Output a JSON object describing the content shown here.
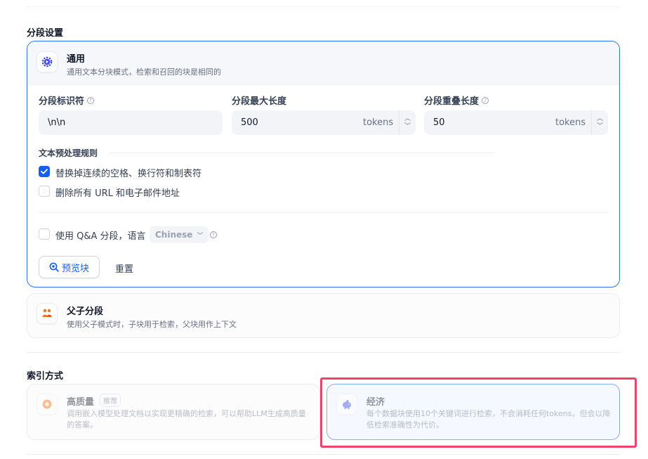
{
  "segment_section": {
    "title": "分段设置"
  },
  "general": {
    "title": "通用",
    "description": "通用文本分块模式，检索和召回的块是相同的",
    "separator": {
      "label": "分段标识符",
      "value": "\\n\\n"
    },
    "max_length": {
      "label": "分段最大长度",
      "value": "500",
      "unit": "tokens"
    },
    "overlap": {
      "label": "分段重叠长度",
      "value": "50",
      "unit": "tokens"
    },
    "rules": {
      "title": "文本预处理规则",
      "items": [
        {
          "label": "替换掉连续的空格、换行符和制表符",
          "checked": true
        },
        {
          "label": "删除所有 URL 和电子邮件地址",
          "checked": false
        }
      ]
    },
    "qa": {
      "label": "使用 Q&A 分段，语言",
      "language": "Chinese",
      "checked": false
    },
    "preview_button": "预览块",
    "reset_button": "重置"
  },
  "parent_child": {
    "title": "父子分段",
    "description": "使用父子模式时，子块用于检索，父块用作上下文"
  },
  "index_section": {
    "title": "索引方式"
  },
  "index_high_quality": {
    "title": "高质量",
    "badge": "推荐",
    "description": "调用嵌入模型处理文档以实现更精确的检索，可以帮助LLM生成高质量的答案。"
  },
  "index_economy": {
    "title": "经济",
    "description": "每个数据块使用10个关键词进行检索，不会消耗任何tokens，但会以降低检索准确性为代价。"
  },
  "colors": {
    "primary": "#155eef",
    "highlight": "#ef4467",
    "orange": "#f97316"
  }
}
